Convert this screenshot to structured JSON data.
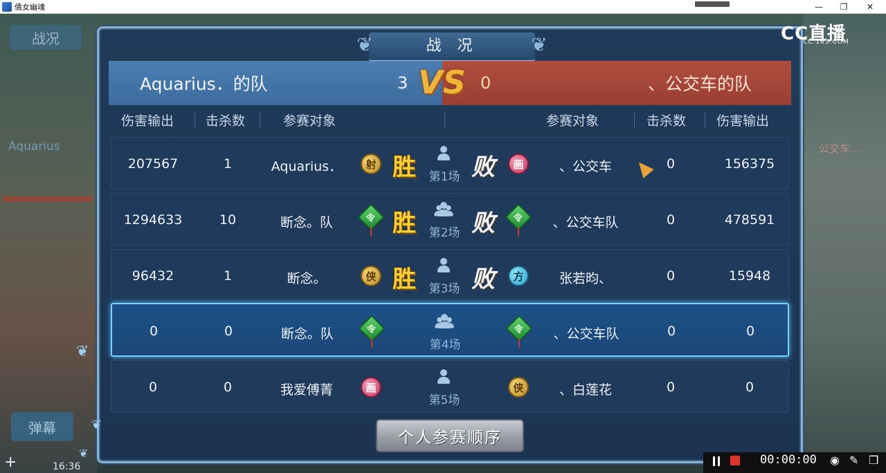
{
  "window": {
    "title": "倩女幽魂",
    "minimize": "—",
    "restore": "❐",
    "close": "✕"
  },
  "background": {
    "war_button": "战况",
    "left_name": "Aquarius",
    "right_name": "公交车...",
    "danmu_button": "弹幕",
    "clock": "16:36",
    "plus": "+"
  },
  "dialog": {
    "title": "战 况",
    "left_team": {
      "name": "Aquarius．的队",
      "score": "3"
    },
    "right_team": {
      "name": "、公交车的队",
      "score": "0"
    },
    "vs": "VS",
    "columns": {
      "dmg_left": "伤害输出",
      "kill_left": "击杀数",
      "player_left": "参赛对象",
      "player_right": "参赛对象",
      "kill_right": "击杀数",
      "dmg_right": "伤害输出"
    },
    "rows": [
      {
        "dmg_l": "207567",
        "kill_l": "1",
        "name_l": "Aquarius．",
        "badge_l": "射",
        "result_l": "胜",
        "round": "第1场",
        "result_r": "败",
        "badge_r": "画",
        "name_r": "、公交车",
        "kill_r": "0",
        "dmg_r": "156375"
      },
      {
        "dmg_l": "1294633",
        "kill_l": "10",
        "name_l": "断念。队",
        "badge_l": "令",
        "result_l": "胜",
        "round": "第2场",
        "result_r": "败",
        "badge_r": "令",
        "name_r": "、公交车队",
        "kill_r": "0",
        "dmg_r": "478591"
      },
      {
        "dmg_l": "96432",
        "kill_l": "1",
        "name_l": "断念。",
        "badge_l": "侠",
        "result_l": "胜",
        "round": "第3场",
        "result_r": "败",
        "badge_r": "方",
        "name_r": "张若昀、",
        "kill_r": "0",
        "dmg_r": "15948"
      },
      {
        "dmg_l": "0",
        "kill_l": "0",
        "name_l": "断念。队",
        "badge_l": "令",
        "result_l": "",
        "round": "第4场",
        "result_r": "",
        "badge_r": "令",
        "name_r": "、公交车队",
        "kill_r": "0",
        "dmg_r": "0"
      },
      {
        "dmg_l": "0",
        "kill_l": "0",
        "name_l": "我爱傅菁",
        "badge_l": "画",
        "result_l": "",
        "round": "第5场",
        "result_r": "",
        "badge_r": "侠",
        "name_r": "、白莲花",
        "kill_r": "0",
        "dmg_r": "0"
      }
    ],
    "order_button": "个人参赛顺序"
  },
  "overlay": {
    "logo": "CC直播",
    "logo_sub": "CC.163.COM",
    "rec_time": "00:00:00"
  },
  "colors": {
    "left_team": "#3d6b9c",
    "right_team": "#9a3e33",
    "win": "#f7d036",
    "active_border": "#7ad2ff"
  }
}
